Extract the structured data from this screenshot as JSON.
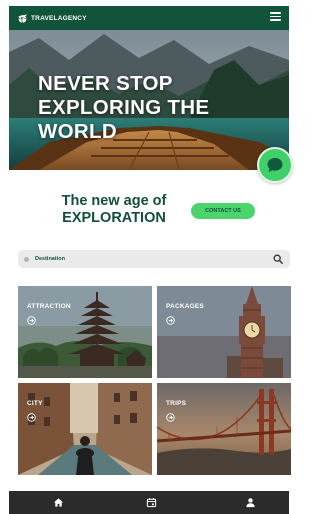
{
  "header": {
    "logo_text": "TRAVELAGENCY",
    "logo_icon": "globe-plane-icon",
    "menu_icon": "hamburger-menu-icon"
  },
  "hero": {
    "title": "NEVER STOP EXPLORING THE WORLD"
  },
  "chat": {
    "icon": "chat-bubble-icon"
  },
  "intro": {
    "tagline_line1": "The new age of",
    "tagline_line2": "EXPLORATION",
    "contact_label": "CONTACT US"
  },
  "search": {
    "placeholder": "Destination",
    "icon": "search-icon"
  },
  "categories": [
    {
      "label": "ATTRACTION",
      "icon": "arrow-circle-icon"
    },
    {
      "label": "PACKAGES",
      "icon": "arrow-circle-icon"
    },
    {
      "label": "CITY",
      "icon": "arrow-circle-icon"
    },
    {
      "label": "TRIPS",
      "icon": "arrow-circle-icon"
    }
  ],
  "bottom_nav": [
    {
      "icon": "home-icon"
    },
    {
      "icon": "calendar-icon"
    },
    {
      "icon": "user-icon"
    }
  ],
  "colors": {
    "brand_dark": "#12533c",
    "accent_green": "#4cd46c",
    "nav_dark": "#2b2b2b",
    "search_bg": "#eaeaea"
  }
}
